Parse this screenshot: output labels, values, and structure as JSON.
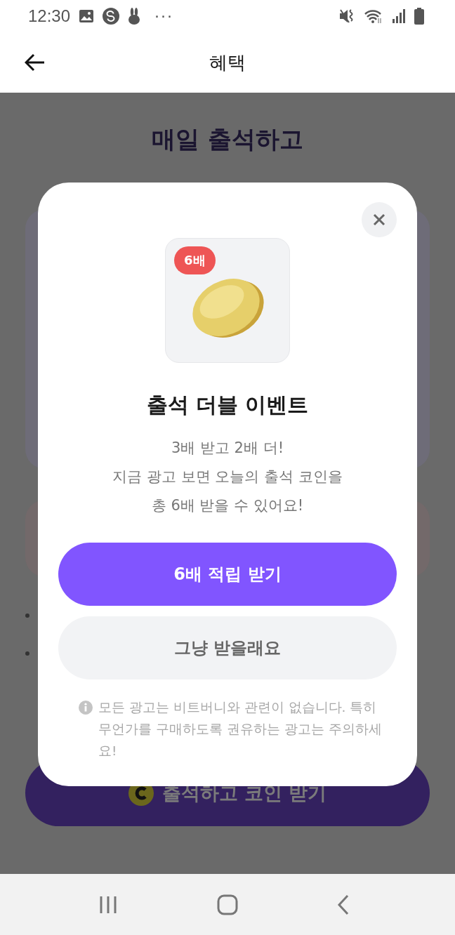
{
  "status_bar": {
    "time": "12:30",
    "overflow": "···"
  },
  "app_bar": {
    "title": "혜택"
  },
  "page": {
    "title_lines": [
      "매일 출석하고"
    ],
    "cta": "출석하고 코인 받기"
  },
  "dialog": {
    "badge": "6배",
    "title": "출석 더블 이벤트",
    "description_lines": [
      "3배 받고 2배 더!",
      "지금 광고 보면 오늘의 출석 코인을",
      "총 6배 받을 수 있어요!"
    ],
    "buttons": [
      {
        "label": "6배 적립 받기",
        "kind": "primary"
      },
      {
        "label": "그냥 받을래요",
        "kind": "secondary"
      }
    ],
    "notice": "모든 광고는 비트버니와 관련이 없습니다. 특히 무언가를 구매하도록 권유하는 광고는 주의하세요!"
  }
}
